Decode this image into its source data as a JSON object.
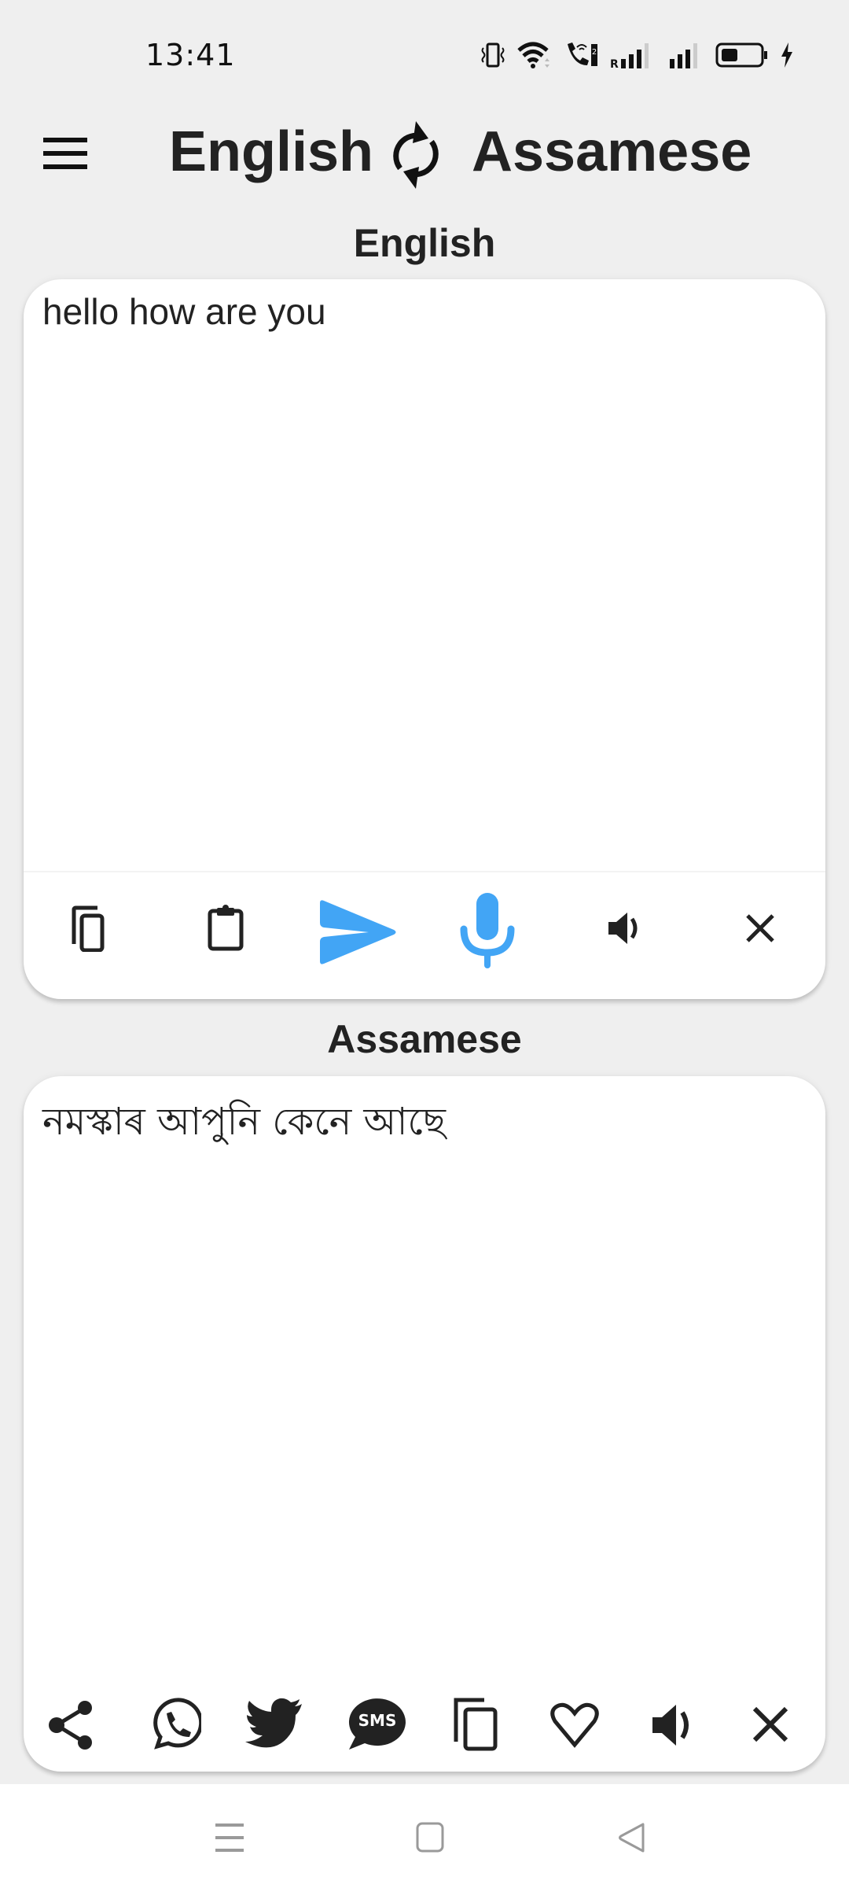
{
  "status_bar": {
    "time": "13:41",
    "icons": [
      "vibrate-icon",
      "wifi-icon",
      "wifi-calling-icon",
      "signal-roaming-icon",
      "signal-icon",
      "battery-icon",
      "charging-icon"
    ],
    "roaming_label": "R",
    "sim_label": "2"
  },
  "header": {
    "menu_icon": "hamburger-menu-icon",
    "source_language": "English",
    "swap_icon": "swap-languages-icon",
    "target_language": "Assamese"
  },
  "source": {
    "label": "English",
    "text": "hello how are you",
    "toolbar": [
      {
        "name": "copy",
        "icon": "copy-icon"
      },
      {
        "name": "paste",
        "icon": "clipboard-icon"
      },
      {
        "name": "translate",
        "icon": "send-icon"
      },
      {
        "name": "voice-input",
        "icon": "microphone-icon"
      },
      {
        "name": "speak",
        "icon": "speaker-icon"
      },
      {
        "name": "clear",
        "icon": "close-icon"
      }
    ]
  },
  "target": {
    "label": "Assamese",
    "text": "নমস্কাৰ আপুনি কেনে আছে",
    "toolbar": [
      {
        "name": "share",
        "icon": "share-icon"
      },
      {
        "name": "whatsapp",
        "icon": "whatsapp-icon"
      },
      {
        "name": "twitter",
        "icon": "twitter-icon"
      },
      {
        "name": "sms",
        "icon": "sms-icon",
        "label": "SMS"
      },
      {
        "name": "copy",
        "icon": "copy-icon"
      },
      {
        "name": "favorite",
        "icon": "heart-icon"
      },
      {
        "name": "speak",
        "icon": "speaker-icon"
      },
      {
        "name": "clear",
        "icon": "close-icon"
      }
    ]
  },
  "colors": {
    "accent": "#42a5f5",
    "background": "#efefef",
    "card": "#ffffff",
    "text": "#222222"
  },
  "nav_bar": {
    "buttons": [
      "recent-apps-icon",
      "home-icon",
      "back-icon"
    ]
  }
}
